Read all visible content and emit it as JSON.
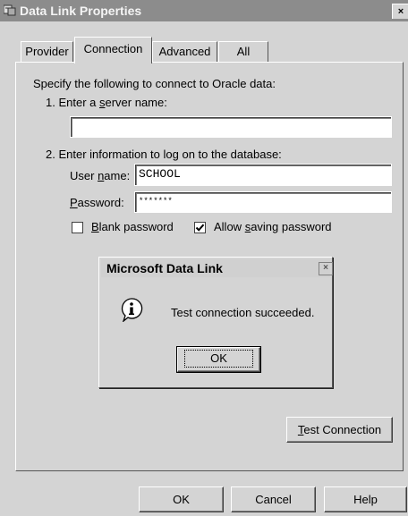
{
  "window": {
    "title": "Data Link Properties",
    "close_glyph": "×"
  },
  "tabs": [
    {
      "label": "Provider",
      "active": false
    },
    {
      "label": "Connection",
      "active": true
    },
    {
      "label": "Advanced",
      "active": false
    },
    {
      "label": "All",
      "active": false
    }
  ],
  "connection": {
    "intro": "Specify the following to connect to Oracle data:",
    "step1_prefix": "1. Enter a ",
    "step1_accel": "s",
    "step1_suffix": "erver name:",
    "server_name_value": "",
    "step2": "2. Enter information to log on to the database:",
    "username_prefix": "User ",
    "username_accel": "n",
    "username_suffix": "ame:",
    "username_value": "SCHOOL",
    "password_accel": "P",
    "password_suffix": "assword:",
    "password_value": "*******",
    "blank_password": {
      "accel": "B",
      "rest": "lank password",
      "checked": false
    },
    "allow_saving": {
      "prefix": "Allow ",
      "accel": "s",
      "rest": "aving password",
      "checked": true
    },
    "test_button": {
      "accel": "T",
      "rest": "est Connection"
    }
  },
  "message_box": {
    "title": "Microsoft Data Link",
    "close_glyph": "×",
    "icon": "info-icon",
    "message": "Test connection succeeded.",
    "ok_label": "OK"
  },
  "footer": {
    "ok_label": "OK",
    "cancel_label": "Cancel",
    "help_label": "Help"
  },
  "colors": {
    "dialog_bg": "#d4d4d4",
    "titlebar_bg": "#8c8c8c"
  }
}
